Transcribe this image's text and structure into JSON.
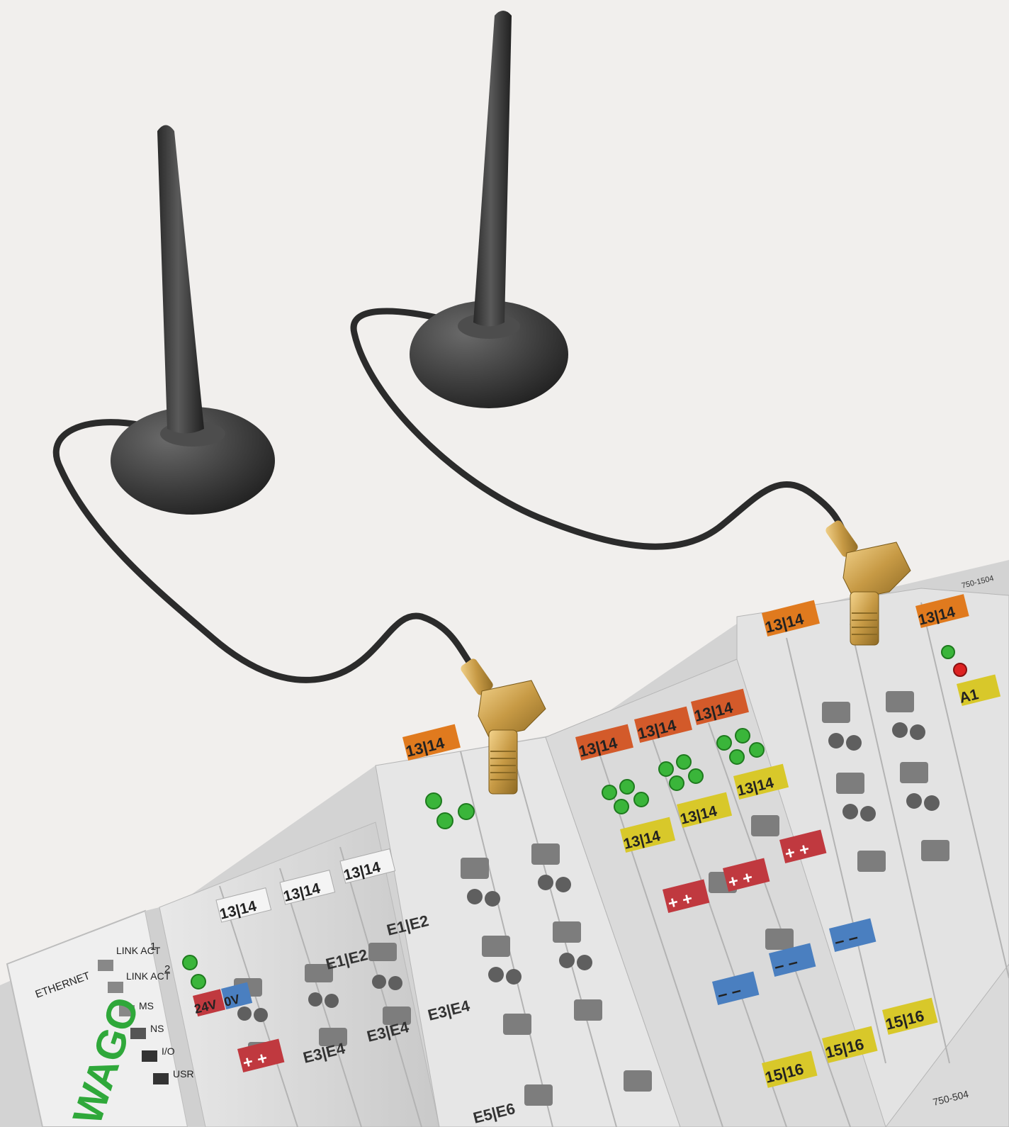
{
  "controller": {
    "ethernet_label": "ETHERNET",
    "port1_label": "1",
    "port2_label": "2",
    "leds": [
      "LINK ACT",
      "LINK ACT",
      "MS",
      "NS",
      "I/O",
      "USR"
    ],
    "brand": "WAGO"
  },
  "terminal_labels": {
    "pair_13_14": [
      "13",
      "14"
    ],
    "pair_15_16": [
      "15",
      "16"
    ],
    "e1_e2": [
      "E1",
      "E2"
    ],
    "e3_e4": [
      "E3",
      "E4"
    ],
    "e5_e6": [
      "E5",
      "E6"
    ],
    "power": [
      "24V",
      "0V"
    ],
    "a1": "A1",
    "plus": "+",
    "minus": "–"
  },
  "part_numbers": [
    "750-1504",
    "750-504"
  ],
  "colors": {
    "background": "#f1efed",
    "antenna": "#3a3a3a",
    "module_body": "#dcdcdc",
    "orange_marker": "#e07a1e",
    "red_marker": "#c0393f",
    "yellow_marker": "#d8c82a",
    "blue_marker": "#4a7fc0",
    "led_green": "#3ab53a",
    "brass": "#d4a850",
    "brand_green": "#2fa83a"
  }
}
